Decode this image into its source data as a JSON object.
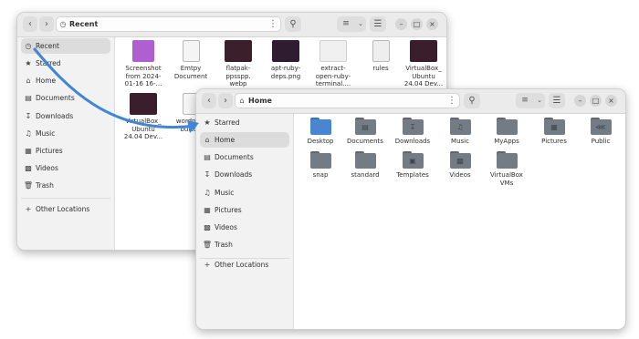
{
  "colors": {
    "accent": "#3f86d6",
    "folder_blue": "#4a86cf",
    "folder_grey": "#737b84"
  },
  "recent_window": {
    "title": "Recent",
    "title_icon": "clock-icon",
    "sidebar": [
      {
        "label": "Recent",
        "icon": "clock-icon",
        "selected": true
      },
      {
        "label": "Starred",
        "icon": "star-icon"
      },
      {
        "label": "Home",
        "icon": "home-icon"
      },
      {
        "label": "Documents",
        "icon": "document-icon"
      },
      {
        "label": "Downloads",
        "icon": "download-icon"
      },
      {
        "label": "Music",
        "icon": "music-icon"
      },
      {
        "label": "Pictures",
        "icon": "pictures-icon"
      },
      {
        "label": "Videos",
        "icon": "video-icon"
      },
      {
        "label": "Trash",
        "icon": "trash-icon"
      }
    ],
    "other_locations": "Other Locations",
    "files": [
      {
        "name_lines": [
          "Screenshot",
          "from 2024-",
          "01-16 16-..."
        ],
        "kind": "image"
      },
      {
        "name_lines": [
          "Emtpy",
          "Document"
        ],
        "kind": "document"
      },
      {
        "name_lines": [
          "flatpak-",
          "ppsspp.",
          "webp"
        ],
        "kind": "screenshot"
      },
      {
        "name_lines": [
          "apt-ruby-",
          "deps.png"
        ],
        "kind": "screenshot"
      },
      {
        "name_lines": [
          "extract-",
          "open-ruby-",
          "terminal...."
        ],
        "kind": "image-light"
      },
      {
        "name_lines": [
          "rules"
        ],
        "kind": "script"
      },
      {
        "name_lines": [
          "VirtualBox_",
          "Ubuntu",
          "24.04 Dev..."
        ],
        "kind": "screenshot"
      },
      {
        "name_lines": [
          "VirtualBox_",
          "Ubuntu",
          "24.04 Dev..."
        ],
        "kind": "screenshot"
      },
      {
        "name_lines": [
          "wordpres",
          "button"
        ],
        "kind": "document"
      }
    ]
  },
  "home_window": {
    "title": "Home",
    "title_icon": "home-icon",
    "sidebar": [
      {
        "label": "Starred",
        "icon": "star-icon"
      },
      {
        "label": "Home",
        "icon": "home-icon",
        "selected": true
      },
      {
        "label": "Documents",
        "icon": "document-icon"
      },
      {
        "label": "Downloads",
        "icon": "download-icon"
      },
      {
        "label": "Music",
        "icon": "music-icon"
      },
      {
        "label": "Pictures",
        "icon": "pictures-icon"
      },
      {
        "label": "Videos",
        "icon": "video-icon"
      },
      {
        "label": "Trash",
        "icon": "trash-icon"
      }
    ],
    "other_locations": "Other Locations",
    "folders": [
      {
        "name_lines": [
          "Desktop"
        ],
        "style": "blue"
      },
      {
        "name_lines": [
          "Documents"
        ],
        "style": "grey",
        "glyph": "document-icon"
      },
      {
        "name_lines": [
          "Downloads"
        ],
        "style": "grey",
        "glyph": "download-icon"
      },
      {
        "name_lines": [
          "Music"
        ],
        "style": "grey",
        "glyph": "music-icon"
      },
      {
        "name_lines": [
          "MyApps"
        ],
        "style": "grey"
      },
      {
        "name_lines": [
          "Pictures"
        ],
        "style": "grey",
        "glyph": "pictures-icon"
      },
      {
        "name_lines": [
          "Public"
        ],
        "style": "grey",
        "glyph": "share-icon"
      },
      {
        "name_lines": [
          "snap"
        ],
        "style": "grey"
      },
      {
        "name_lines": [
          "standard"
        ],
        "style": "grey"
      },
      {
        "name_lines": [
          "Templates"
        ],
        "style": "grey",
        "glyph": "template-icon"
      },
      {
        "name_lines": [
          "Videos"
        ],
        "style": "grey",
        "glyph": "video-icon"
      },
      {
        "name_lines": [
          "VirtualBox",
          "VMs"
        ],
        "style": "grey"
      }
    ]
  }
}
